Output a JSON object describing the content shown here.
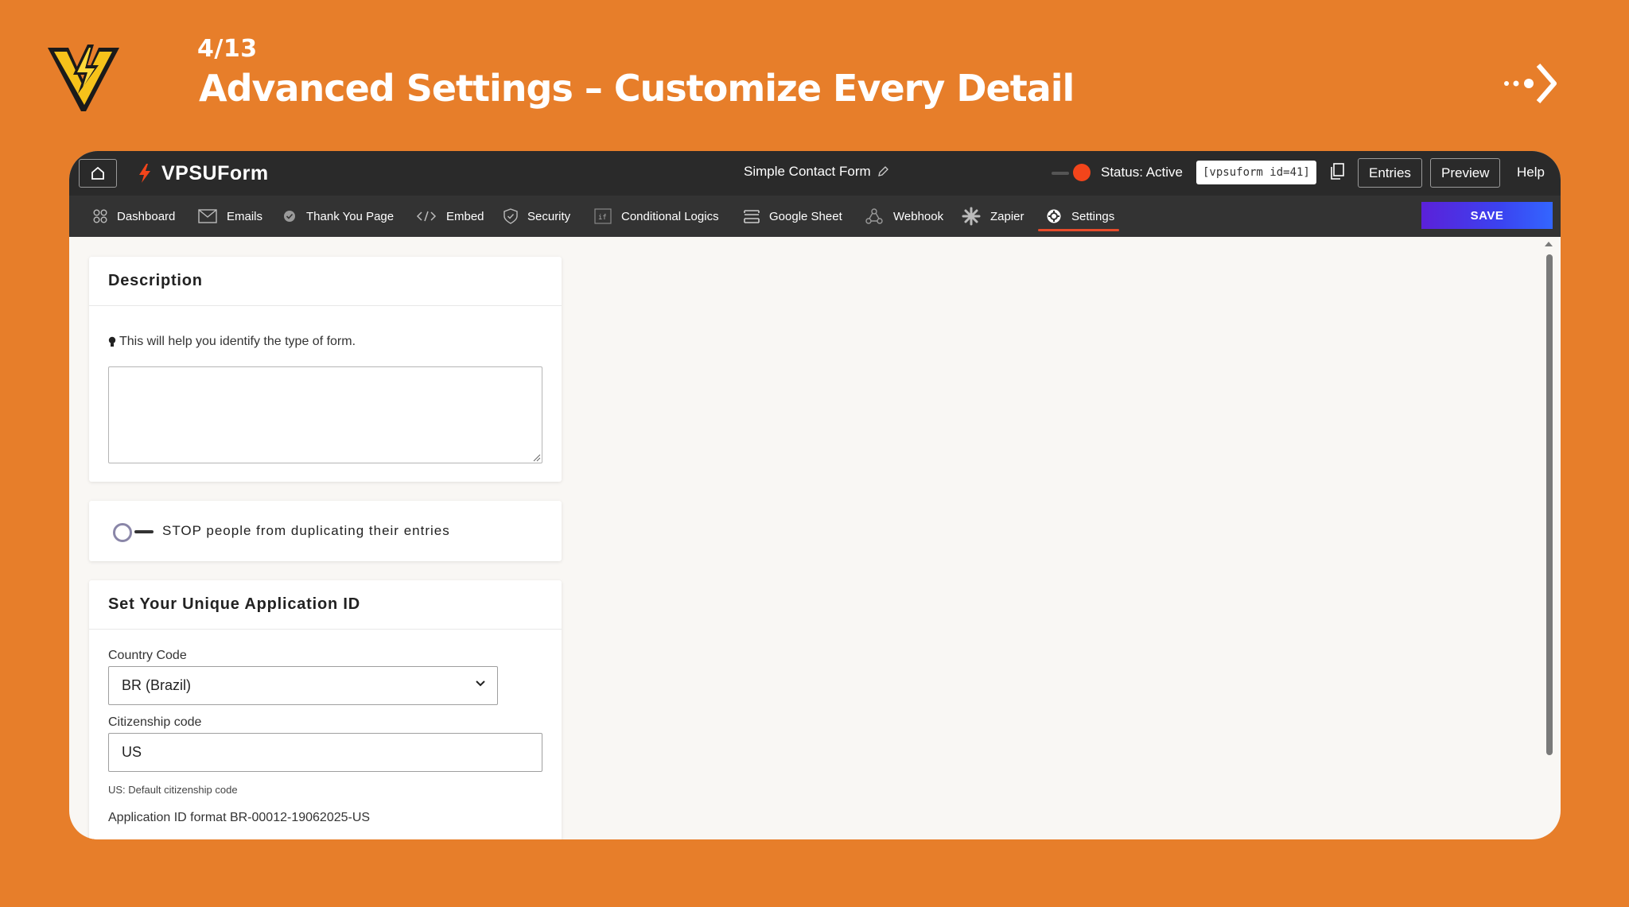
{
  "slide": {
    "step": "4/13",
    "headline": "Advanced Settings – Customize Every Detail"
  },
  "app": {
    "brand": "VPSUForm",
    "form_name": "Simple Contact Form",
    "status": "Status: Active",
    "shortcode": "[vpsuform id=41]",
    "buttons": {
      "entries": "Entries",
      "preview": "Preview",
      "help": "Help",
      "save": "SAVE"
    }
  },
  "nav": {
    "items": [
      {
        "label": "Dashboard",
        "icon": "grid-icon"
      },
      {
        "label": "Emails",
        "icon": "mail-icon"
      },
      {
        "label": "Thank You Page",
        "icon": "check-circle-icon"
      },
      {
        "label": "Embed",
        "icon": "code-icon"
      },
      {
        "label": "Security",
        "icon": "shield-icon"
      },
      {
        "label": "Conditional Logics",
        "icon": "if-icon"
      },
      {
        "label": "Google Sheet",
        "icon": "sheet-icon"
      },
      {
        "label": "Webhook",
        "icon": "webhook-icon"
      },
      {
        "label": "Zapier",
        "icon": "zapier-icon"
      },
      {
        "label": "Settings",
        "icon": "gear-icon",
        "active": true
      }
    ]
  },
  "description_card": {
    "title": "Description",
    "hint": "This will help you identify the type of form.",
    "textarea_value": ""
  },
  "duplicate_card": {
    "label": "STOP people from duplicating their entries",
    "enabled": false
  },
  "app_id_card": {
    "title": "Set Your Unique Application ID",
    "country_label": "Country Code",
    "country_value": "BR (Brazil)",
    "citizenship_label": "Citizenship code",
    "citizenship_value": "US",
    "citizenship_note": "US: Default citizenship code",
    "format_text": "Application ID format BR-00012-19062025-US"
  },
  "colors": {
    "background": "#E77E2A",
    "topbar": "#2A2A2A",
    "accent": "#E74C2B",
    "save_gradient_start": "#5B21D9",
    "save_gradient_end": "#3366FF"
  }
}
